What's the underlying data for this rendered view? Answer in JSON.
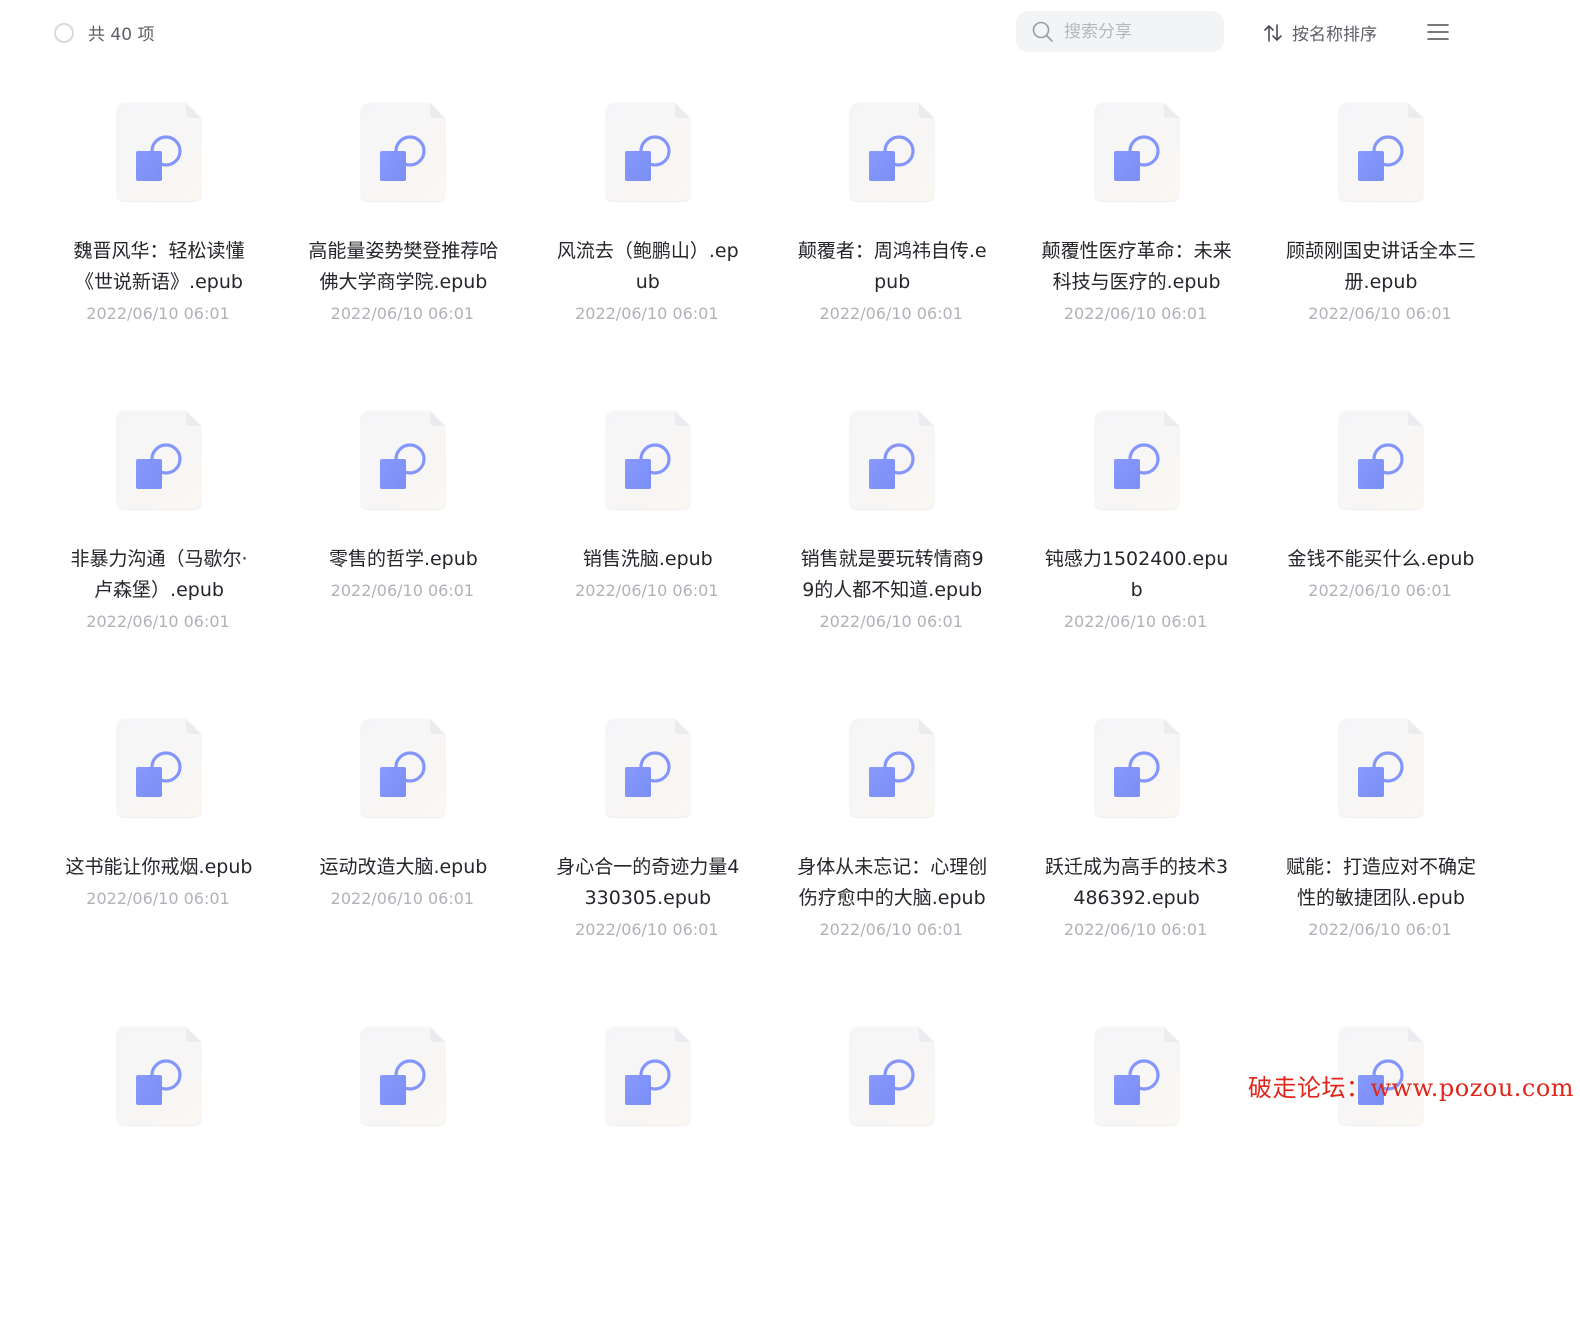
{
  "header": {
    "item_count": "共 40 项",
    "search_placeholder": "搜索分享",
    "sort_label": "按名称排序",
    "icons": {
      "search": "search-icon",
      "sort": "sort-icon",
      "menu": "menu-icon"
    }
  },
  "files": [
    {
      "name": "魏晋风华：轻松读懂《世说新语》.epub",
      "date": "2022/06/10 06:01"
    },
    {
      "name": "高能量姿势樊登推荐哈佛大学商学院.epub",
      "date": "2022/06/10 06:01"
    },
    {
      "name": "风流去（鲍鹏山）.epub",
      "date": "2022/06/10 06:01"
    },
    {
      "name": "颠覆者：周鸿祎自传.epub",
      "date": "2022/06/10 06:01"
    },
    {
      "name": "颠覆性医疗革命：未来科技与医疗的.epub",
      "date": "2022/06/10 06:01"
    },
    {
      "name": "顾颉刚国史讲话全本三册.epub",
      "date": "2022/06/10 06:01"
    },
    {
      "name": "非暴力沟通（马歇尔·卢森堡）.epub",
      "date": "2022/06/10 06:01"
    },
    {
      "name": "零售的哲学.epub",
      "date": "2022/06/10 06:01"
    },
    {
      "name": "销售洗脑.epub",
      "date": "2022/06/10 06:01"
    },
    {
      "name": "销售就是要玩转情商99的人都不知道.epub",
      "date": "2022/06/10 06:01"
    },
    {
      "name": "钝感力1502400.epub",
      "date": "2022/06/10 06:01"
    },
    {
      "name": "金钱不能买什么.epub",
      "date": "2022/06/10 06:01"
    },
    {
      "name": "这书能让你戒烟.epub",
      "date": "2022/06/10 06:01"
    },
    {
      "name": "运动改造大脑.epub",
      "date": "2022/06/10 06:01"
    },
    {
      "name": "身心合一的奇迹力量4330305.epub",
      "date": "2022/06/10 06:01"
    },
    {
      "name": "身体从未忘记：心理创伤疗愈中的大脑.epub",
      "date": "2022/06/10 06:01"
    },
    {
      "name": "跃迁成为高手的技术3486392.epub",
      "date": "2022/06/10 06:01"
    },
    {
      "name": "赋能：打造应对不确定性的敏捷团队.epub",
      "date": "2022/06/10 06:01"
    },
    {
      "name": "",
      "date": ""
    },
    {
      "name": "",
      "date": ""
    },
    {
      "name": "",
      "date": ""
    },
    {
      "name": "",
      "date": ""
    },
    {
      "name": "",
      "date": ""
    },
    {
      "name": "",
      "date": ""
    }
  ],
  "watermark": "破走论坛：www.pozou.com",
  "colors": {
    "accent": "#7b8cf5",
    "icon_fill": "#7f92fb",
    "text_primary": "#25262b",
    "text_secondary": "#b0b2b8",
    "watermark": "#e0261b"
  }
}
